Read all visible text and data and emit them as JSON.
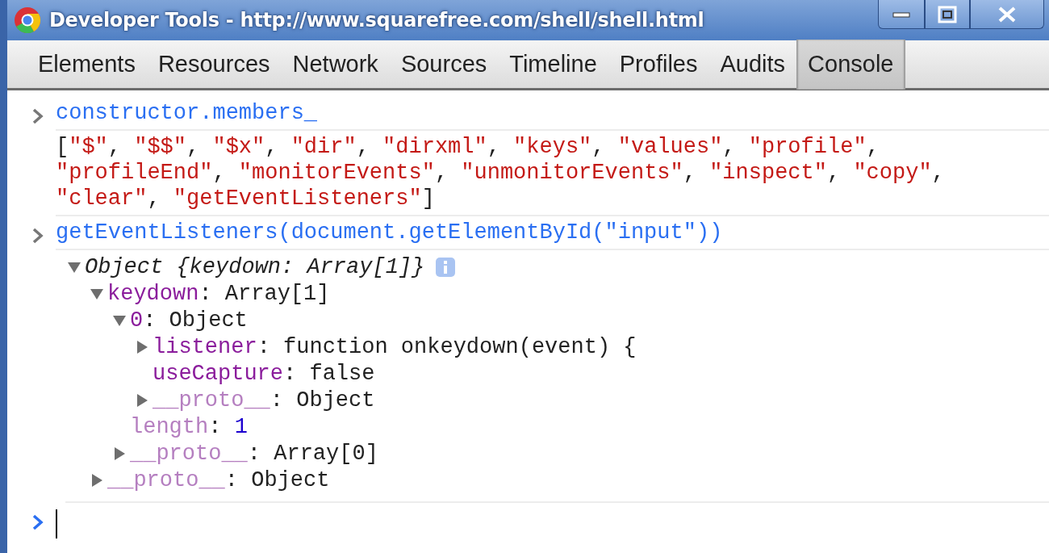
{
  "window": {
    "title": "Developer Tools - http://www.squarefree.com/shell/shell.html"
  },
  "tabs": [
    {
      "label": "Elements",
      "selected": false
    },
    {
      "label": "Resources",
      "selected": false
    },
    {
      "label": "Network",
      "selected": false
    },
    {
      "label": "Sources",
      "selected": false
    },
    {
      "label": "Timeline",
      "selected": false
    },
    {
      "label": "Profiles",
      "selected": false
    },
    {
      "label": "Audits",
      "selected": false
    },
    {
      "label": "Console",
      "selected": true
    }
  ],
  "console": [
    {
      "kind": "command",
      "text": "constructor.members_"
    },
    {
      "kind": "array_result",
      "lines": [
        "[\"$\", \"$$\", \"$x\", \"dir\", \"dirxml\", \"keys\", \"values\", \"profile\",",
        "\"profileEnd\", \"monitorEvents\", \"unmonitorEvents\", \"inspect\", \"copy\",",
        "\"clear\", \"getEventListeners\"]"
      ]
    },
    {
      "kind": "command",
      "text": "getEventListeners(document.getElementById(\"input\"))"
    },
    {
      "kind": "tree_result",
      "tree": {
        "text": "Object {keydown: Array[1]}",
        "kind": "summary",
        "expanded": true,
        "children": [
          {
            "text": "keydown: Array[1]",
            "expanded": true,
            "dimmed": false,
            "kind": "plain",
            "children": [
              {
                "text": "0: Object",
                "expanded": true,
                "dimmed": false,
                "kind": "plain",
                "children": [
                  {
                    "text": "listener: function onkeydown(event) {",
                    "expanded": false,
                    "dimmed": false,
                    "kind": "plain"
                  },
                  {
                    "text": "useCapture: false",
                    "dimmed": false,
                    "kind": "plain"
                  },
                  {
                    "text": "__proto__: Object",
                    "expanded": false,
                    "dimmed": true,
                    "kind": "plain"
                  }
                ]
              },
              {
                "text": "length: 1",
                "dimmed": true,
                "kind": "number"
              },
              {
                "text": "__proto__: Array[0]",
                "expanded": false,
                "dimmed": true,
                "kind": "plain"
              }
            ]
          },
          {
            "text": "__proto__: Object",
            "expanded": false,
            "dimmed": true,
            "kind": "plain"
          }
        ]
      }
    }
  ]
}
